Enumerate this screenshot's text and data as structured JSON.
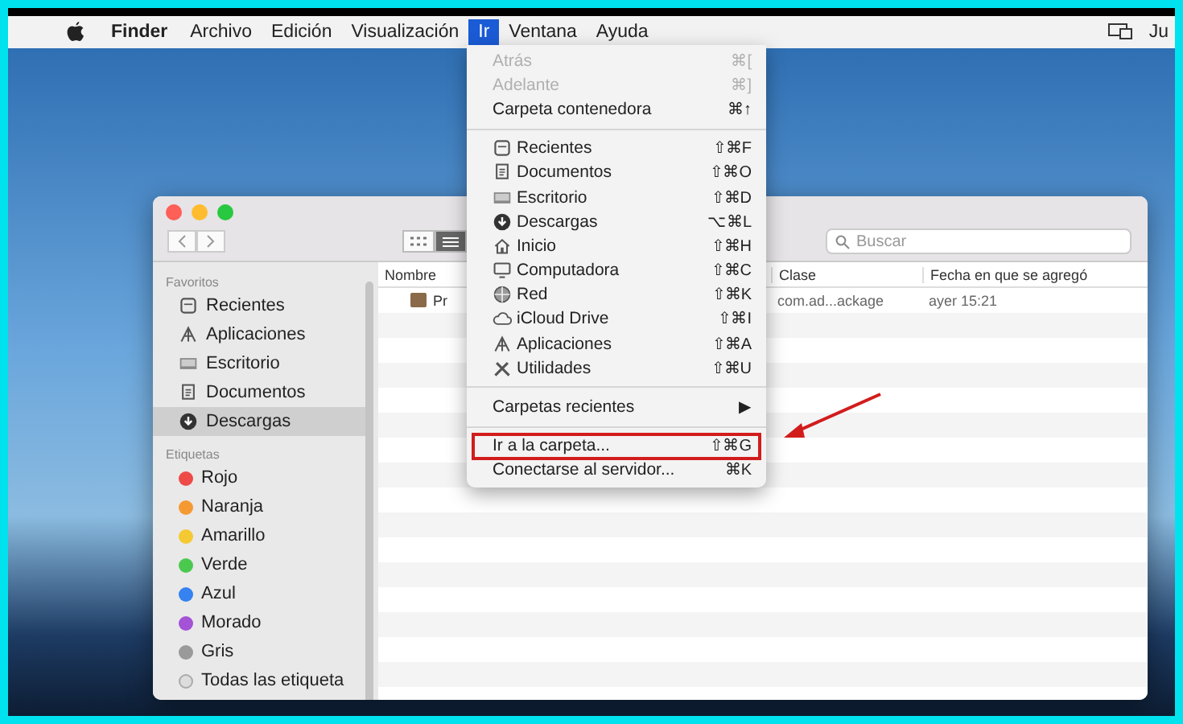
{
  "menubar": {
    "app_name": "Finder",
    "menus": [
      {
        "label": "Archivo",
        "selected": false
      },
      {
        "label": "Edición",
        "selected": false
      },
      {
        "label": "Visualización",
        "selected": false
      },
      {
        "label": "Ir",
        "selected": true
      },
      {
        "label": "Ventana",
        "selected": false
      },
      {
        "label": "Ayuda",
        "selected": false
      }
    ],
    "clock": "Ju"
  },
  "go_menu": {
    "items": [
      {
        "kind": "item",
        "label": "Atrás",
        "shortcut": "⌘[",
        "disabled": true,
        "annotated": false
      },
      {
        "kind": "item",
        "label": "Adelante",
        "shortcut": "⌘]",
        "disabled": true,
        "annotated": false
      },
      {
        "kind": "item",
        "label": "Carpeta contenedora",
        "shortcut": "⌘↑",
        "disabled": false,
        "annotated": false
      },
      {
        "kind": "separator"
      },
      {
        "kind": "place",
        "label": "Recientes",
        "shortcut": "⇧⌘F",
        "disabled": false,
        "annotated": false
      },
      {
        "kind": "place",
        "label": "Documentos",
        "shortcut": "⇧⌘O",
        "disabled": false,
        "annotated": false
      },
      {
        "kind": "place",
        "label": "Escritorio",
        "shortcut": "⇧⌘D",
        "disabled": false,
        "annotated": false
      },
      {
        "kind": "place",
        "label": "Descargas",
        "shortcut": "⌥⌘L",
        "disabled": false,
        "annotated": false
      },
      {
        "kind": "place",
        "label": "Inicio",
        "shortcut": "⇧⌘H",
        "disabled": false,
        "annotated": false
      },
      {
        "kind": "place",
        "label": "Computadora",
        "shortcut": "⇧⌘C",
        "disabled": false,
        "annotated": false
      },
      {
        "kind": "place",
        "label": "Red",
        "shortcut": "⇧⌘K",
        "disabled": false,
        "annotated": false
      },
      {
        "kind": "place",
        "label": "iCloud Drive",
        "shortcut": "⇧⌘I",
        "disabled": false,
        "annotated": false
      },
      {
        "kind": "place",
        "label": "Aplicaciones",
        "shortcut": "⇧⌘A",
        "disabled": false,
        "annotated": false
      },
      {
        "kind": "place",
        "label": "Utilidades",
        "shortcut": "⇧⌘U",
        "disabled": false,
        "annotated": false
      },
      {
        "kind": "separator"
      },
      {
        "kind": "submenu",
        "label": "Carpetas recientes",
        "shortcut": "▶",
        "disabled": false,
        "annotated": false
      },
      {
        "kind": "separator"
      },
      {
        "kind": "item",
        "label": "Ir a la carpeta...",
        "shortcut": "⇧⌘G",
        "disabled": false,
        "annotated": true
      },
      {
        "kind": "item",
        "label": "Conectarse al servidor...",
        "shortcut": "⌘K",
        "disabled": false,
        "annotated": false
      }
    ]
  },
  "finder_window": {
    "search": {
      "placeholder": "Buscar"
    },
    "view_buttons": [
      {
        "selected": false
      },
      {
        "selected": true
      }
    ],
    "sidebar": {
      "favorites_header": "Favoritos",
      "favorites": [
        {
          "label": "Recientes",
          "selected": false
        },
        {
          "label": "Aplicaciones",
          "selected": false
        },
        {
          "label": "Escritorio",
          "selected": false
        },
        {
          "label": "Documentos",
          "selected": false
        },
        {
          "label": "Descargas",
          "selected": true
        }
      ],
      "tags_header": "Etiquetas",
      "tags": [
        {
          "label": "Rojo",
          "color": "#ee4a48"
        },
        {
          "label": "Naranja",
          "color": "#f59a32"
        },
        {
          "label": "Amarillo",
          "color": "#f5c932"
        },
        {
          "label": "Verde",
          "color": "#4bc94e"
        },
        {
          "label": "Azul",
          "color": "#3582f0"
        },
        {
          "label": "Morado",
          "color": "#a452d6"
        },
        {
          "label": "Gris",
          "color": "#9a9a9a"
        }
      ],
      "all_tags": "Todas las etiqueta"
    },
    "table": {
      "columns": [
        "Nombre",
        "Clase",
        "Fecha en que se agregó"
      ],
      "rows": [
        {
          "name": "Pr",
          "kind": "com.ad...ackage",
          "date": "ayer 15:21"
        }
      ]
    }
  }
}
